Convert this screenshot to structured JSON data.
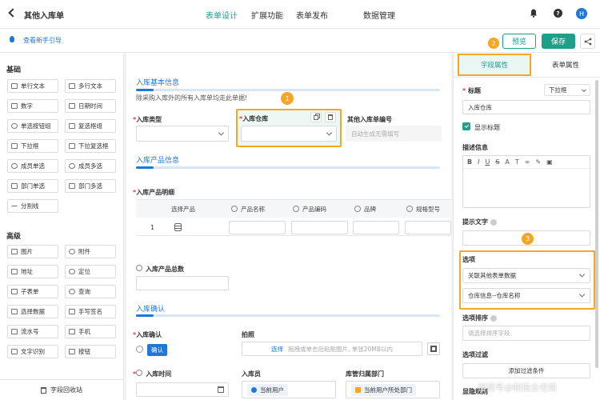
{
  "app": {
    "title": "其他入库单",
    "avatar_letter": "H"
  },
  "nav": {
    "tabs": [
      "表单设计",
      "扩展功能",
      "表单发布",
      "数据管理"
    ],
    "active_index": 0
  },
  "subbar": {
    "guide": "查看新手引导",
    "preview": "预览",
    "save": "保存",
    "badge": "2"
  },
  "left": {
    "section_basic": "基础",
    "basic": [
      "单行文本",
      "多行文本",
      "数字",
      "日期时间",
      "单选按钮组",
      "复选框组",
      "下拉框",
      "下拉复选框",
      "成员单选",
      "成员多选",
      "部门单选",
      "部门多选",
      "分割线"
    ],
    "section_advanced": "高级",
    "advanced": [
      "图片",
      "附件",
      "地址",
      "定位",
      "子表单",
      "查询",
      "选择数据",
      "手写签名",
      "流水号",
      "手机",
      "文字识别",
      "按钮"
    ],
    "recycle": "字段回收站"
  },
  "canvas": {
    "sec1": "入库基本信息",
    "sec1_desc": "除采购入库外的所有入库单均走此单据!",
    "f_type": "入库类型",
    "f_warehouse": "入库仓库",
    "badge1": "1",
    "f_other_no": "其他入库单编号",
    "f_other_no_ph": "自动生成无需填写",
    "sec2": "入库产品信息",
    "f_detail": "入库产品明细",
    "table_headers": [
      "选择产品",
      "产品名称",
      "产品编码",
      "品牌",
      "规格型号"
    ],
    "row_no": "1",
    "f_total": "入库产品总数",
    "sec3": "入库确认",
    "f_confirm": "入库确认",
    "confirm_btn": "确认",
    "f_photo": "拍照",
    "photo_select": "选择",
    "photo_hint": "拖拽或单击后粘贴图片, 单张20MB以内",
    "f_time": "入库时间",
    "f_person": "入库员",
    "person_val": "当前用户",
    "f_dept": "库管归属部门",
    "dept_val": "当前用户所处部门"
  },
  "right": {
    "tab_field": "字段属性",
    "tab_form": "表单属性",
    "title_label": "标题",
    "title_type": "下拉框",
    "title_value": "入库仓库",
    "show_title": "显示标题",
    "desc_label": "描述信息",
    "hint_label": "提示文字",
    "badge3": "3",
    "options_label": "选项",
    "option_source": "关联其他表单数据",
    "option_field": "仓库信息--仓库名称",
    "sort_label": "选项排序",
    "sort_ph": "请选择排序字段",
    "filter_label": "选项过滤",
    "add_filter": "添加过滤条件",
    "display_rule": "显隐规则",
    "watermark": "搜狐号@制造业老简"
  },
  "colors": {
    "primary": "#1f9e8a",
    "accent": "#f5a623",
    "link": "#1f77d6",
    "required": "#e53935"
  }
}
